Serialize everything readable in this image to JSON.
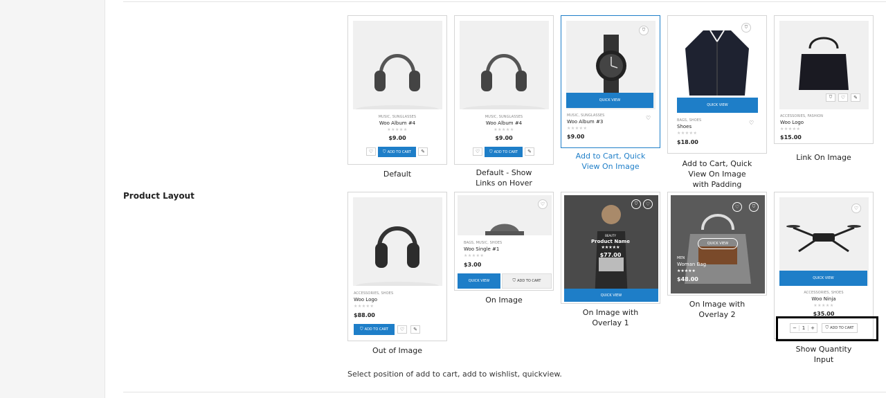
{
  "section": {
    "label": "Product Layout",
    "help_text": "Select position of add to cart, add to wishlist, quickview."
  },
  "labels": {
    "add_to_cart": "ADD TO CART",
    "quick_view": "QUICK VIEW",
    "stars_gray": "★★★★★",
    "stars_white": "★★★★★"
  },
  "icons": {
    "cart": "cart-icon",
    "heart": "heart-icon",
    "edit": "edit-icon",
    "minus": "minus-icon",
    "plus": "plus-icon"
  },
  "colors": {
    "accent": "#1e7ec8",
    "card_border": "#d5d5d5",
    "image_bg": "#f0f0f0",
    "overlay_dark": "#3a3a3a"
  },
  "options": [
    {
      "caption_line1": "Default",
      "caption_line2": "",
      "category": "MUSIC, SUNGLASSES",
      "name": "Woo Album #4",
      "price": "$9.00"
    },
    {
      "caption_line1": "Default - Show",
      "caption_line2": "Links on Hover",
      "category": "MUSIC, SUNGLASSES",
      "name": "Woo Album #4",
      "price": "$9.00"
    },
    {
      "caption_line1": "Add to Cart, Quick",
      "caption_line2": "View On Image",
      "category": "MUSIC, SUNGLASSES",
      "name": "Woo Album #3",
      "price": "$9.00"
    },
    {
      "caption_line1": "Add to Cart, Quick",
      "caption_line2": "View On Image",
      "caption_line3": "with Padding",
      "category": "BAGS, SHOES",
      "name": "Shoes",
      "price": "$18.00"
    },
    {
      "caption_line1": "Link On Image",
      "caption_line2": "",
      "category": "ACCESSORIES, FASHION",
      "name": "Woo Logo",
      "price": "$15.00"
    },
    {
      "caption_line1": "Out of Image",
      "caption_line2": "",
      "category": "ACCESSORIES, SHOES",
      "name": "Woo Logo",
      "price": "$88.00"
    },
    {
      "caption_line1": "On Image",
      "caption_line2": "",
      "category": "BAGS, MUSIC, SHOES",
      "name": "Woo Single #1",
      "price": "$3.00"
    },
    {
      "caption_line1": "On Image with",
      "caption_line2": "Overlay 1",
      "category": "BEAUTY",
      "name": "Product Name",
      "price": "$77.00"
    },
    {
      "caption_line1": "On Image with",
      "caption_line2": "Overlay 2",
      "category": "MEN",
      "name": "Woman Bag",
      "price": "$48.00"
    },
    {
      "caption_line1": "Show Quantity",
      "caption_line2": "Input",
      "category": "ACCESSORIES, SHOES",
      "name": "Woo Ninja",
      "price": "$35.00",
      "quantity": "1"
    }
  ]
}
